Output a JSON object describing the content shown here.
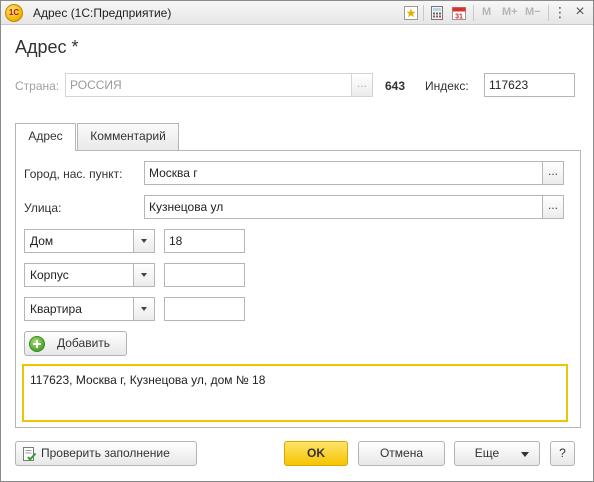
{
  "window": {
    "title": "Адрес  (1С:Предприятие)",
    "logo_text": "1С",
    "memory_buttons": [
      "M",
      "M+",
      "M−"
    ],
    "controls": {
      "menu": "⋮",
      "close": "×"
    }
  },
  "form": {
    "title": "Адрес *"
  },
  "country": {
    "label": "Страна:",
    "value": "РОССИЯ",
    "select_button": "...",
    "code": "643"
  },
  "index": {
    "label": "Индекс:",
    "value": "117623"
  },
  "tabs": [
    {
      "label": "Адрес",
      "active": true
    },
    {
      "label": "Комментарий",
      "active": false
    }
  ],
  "address": {
    "city_label": "Город, нас. пункт:",
    "city_value": "Москва г",
    "street_label": "Улица:",
    "street_value": "Кузнецова ул",
    "select_button": "...",
    "building_rows": [
      {
        "type": "Дом",
        "value": "18"
      },
      {
        "type": "Корпус",
        "value": ""
      },
      {
        "type": "Квартира",
        "value": ""
      }
    ],
    "add_button": "Добавить",
    "full_address": "117623, Москва г, Кузнецова ул, дом № 18"
  },
  "footer": {
    "check_button": "Проверить заполнение",
    "ok_button": "OK",
    "cancel_button": "Отмена",
    "more_button": "Еще",
    "help_button": "?"
  },
  "colors": {
    "accent_yellow": "#f5c400",
    "highlight_border": "#f0c400"
  }
}
